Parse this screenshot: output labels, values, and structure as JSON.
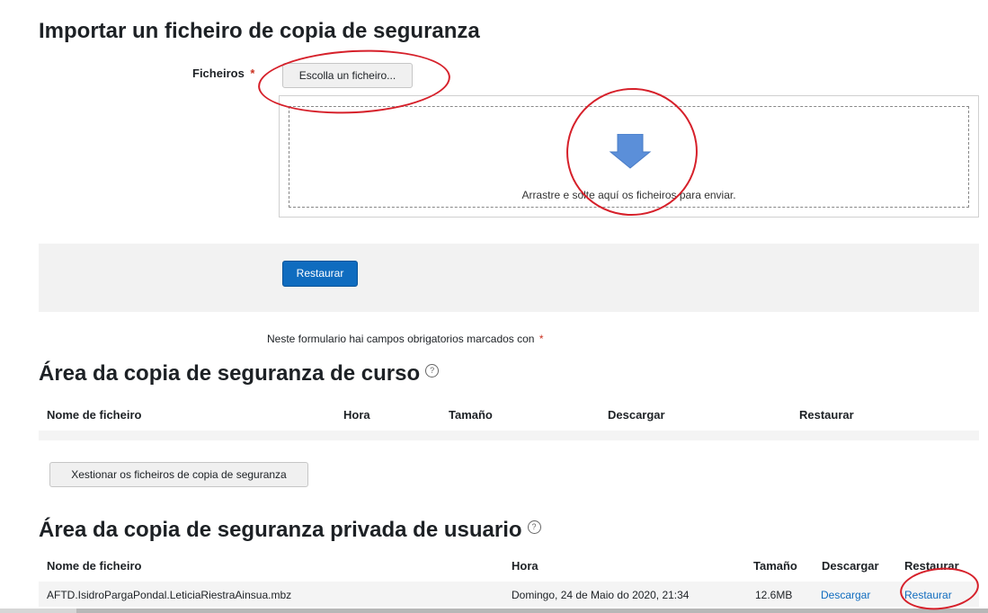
{
  "import_section": {
    "title": "Importar un ficheiro de copia de seguranza",
    "files_label": "Ficheiros",
    "required_mark": "*",
    "choose_file_button": "Escolla un ficheiro...",
    "dropzone_text": "Arrastre e solte aquí os ficheiros para enviar.",
    "restore_button": "Restaurar",
    "required_note": "Neste formulario hai campos obrigatorios marcados con"
  },
  "course_backup": {
    "title": "Área da copia de seguranza de curso",
    "columns": [
      "Nome de ficheiro",
      "Hora",
      "Tamaño",
      "Descargar",
      "Restaurar"
    ],
    "manage_button": "Xestionar os ficheiros de copia de seguranza"
  },
  "user_backup": {
    "title": "Área da copia de seguranza privada de usuario",
    "columns": [
      "Nome de ficheiro",
      "Hora",
      "Tamaño",
      "Descargar",
      "Restaurar"
    ],
    "rows": [
      {
        "filename": "AFTD.IsidroPargaPondal.LeticiaRiestraAinsua.mbz",
        "time": "Domingo, 24 de Maio do 2020, 21:34",
        "size": "12.6MB",
        "download": "Descargar",
        "restore": "Restaurar"
      }
    ]
  },
  "icons": {
    "help": "help-circle-icon",
    "download_arrow": "down-arrow-icon"
  },
  "colors": {
    "accent": "#0f6cbf",
    "required": "#ca3120",
    "annotation": "#d6202a",
    "arrow": "#5b8fd9"
  }
}
